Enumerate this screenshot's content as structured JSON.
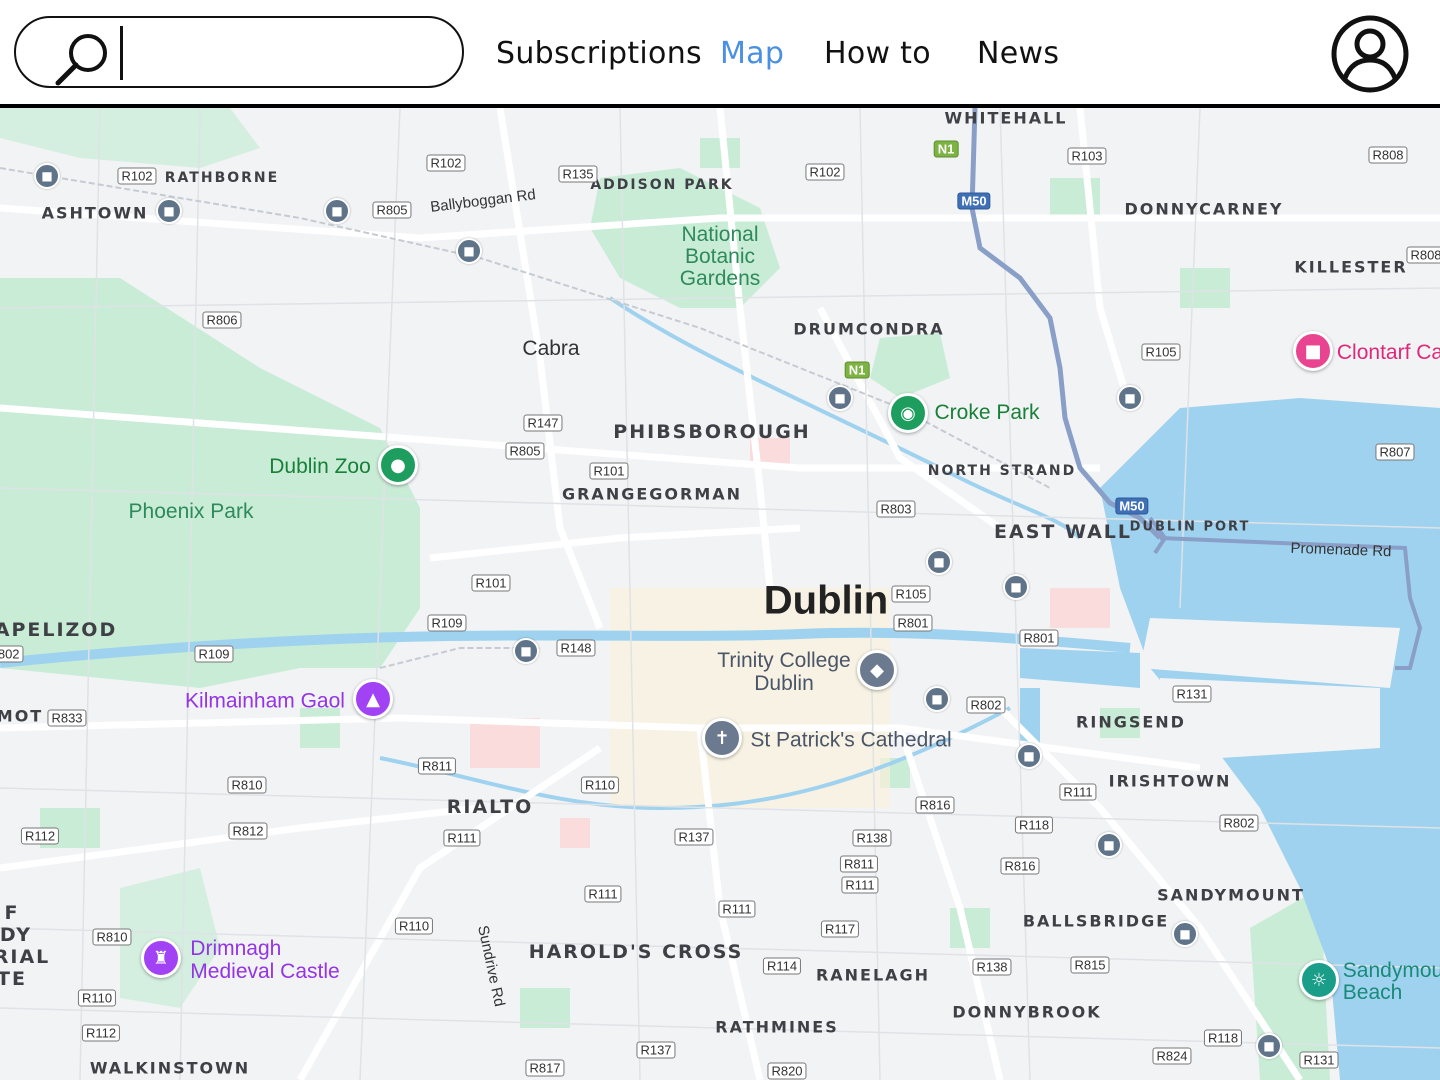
{
  "header": {
    "search": {
      "placeholder": "",
      "value": ""
    },
    "nav": [
      {
        "label": "Subscriptions",
        "active": false
      },
      {
        "label": "Map",
        "active": true
      },
      {
        "label": "How to",
        "active": false
      },
      {
        "label": "News",
        "active": false
      }
    ]
  },
  "map": {
    "city": "Dublin",
    "districts": {
      "whitehall": "WHITEHALL",
      "rathborne": "RATHBORNE",
      "ashtown": "ASHTOWN",
      "addison_park": "ADDISON PARK",
      "donnycarney": "DONNYCARNEY",
      "killester": "KILLESTER",
      "drumcondra": "DRUMCONDRA",
      "phibsborough": "PHIBSBOROUGH",
      "grangegorman": "GRANGEGORMAN",
      "north_strand": "NORTH STRAND",
      "east_wall": "EAST WALL",
      "dublin_port": "DUBLIN PORT",
      "chapelizod": "APELIZOD",
      "ringsend": "RINGSEND",
      "irishtown": "IRISHTOWN",
      "rialto": "RIALTO",
      "sandymount": "SANDYMOUNT",
      "ballsbridge": "BALLSBRIDGE",
      "harolds_cross": "HAROLD'S CROSS",
      "ranelagh": "RANELAGH",
      "rathmines": "RATHMINES",
      "donnybrook": "DONNYBROOK",
      "walkinstown": "WALKINSTOWN",
      "mot": "MOT",
      "edge_f": "F",
      "edge_dy": "DY",
      "edge_rial": "RIAL",
      "edge_te": "TE"
    },
    "localities": {
      "cabra": "Cabra"
    },
    "parks": {
      "botanic_line1": "National",
      "botanic_line2": "Botanic",
      "botanic_line3": "Gardens",
      "phoenix_park": "Phoenix Park"
    },
    "pois": {
      "dublin_zoo": "Dublin Zoo",
      "croke_park": "Croke Park",
      "clontarf": "Clontarf Ca",
      "kilmainham": "Kilmainham Gaol",
      "trinity_line1": "Trinity College",
      "trinity_line2": "Dublin",
      "st_patricks": "St Patrick's Cathedral",
      "drimnagh_line1": "Drimnagh",
      "drimnagh_line2": "Medieval Castle",
      "sandymount_beach_line1": "Sandymou",
      "sandymount_beach_line2": "Beach"
    },
    "streets": {
      "ballyboggan": "Ballyboggan Rd",
      "promenade": "Promenade Rd",
      "sundrive": "Sundrive Rd"
    },
    "road_shields": [
      "R102",
      "R102",
      "R135",
      "R102",
      "R103",
      "R808",
      "R805",
      "R808",
      "R806",
      "R105",
      "N1",
      "N1",
      "M50",
      "M50",
      "R147",
      "R805",
      "R101",
      "R807",
      "R803",
      "R101",
      "R105",
      "R109",
      "R801",
      "R801",
      "R148",
      "R109",
      "R802",
      "R131",
      "R833",
      "R811",
      "R810",
      "R110",
      "R111",
      "R816",
      "R812",
      "R118",
      "R802",
      "R112",
      "R111",
      "R137",
      "R138",
      "R811",
      "R111",
      "R816",
      "R111",
      "R111",
      "R810",
      "R110",
      "R117",
      "R110",
      "R114",
      "R138",
      "R815",
      "R112",
      "R137",
      "R118",
      "R824",
      "R817",
      "R820",
      "R131",
      "R802"
    ],
    "colors": {
      "land": "#f2f3f5",
      "park": "#c9ecd6",
      "park_dark": "#a8e0bf",
      "water": "#9fd2ef",
      "motorway": "#8a9fc7",
      "road": "#ffffff",
      "accent": "#4a90e2"
    }
  }
}
